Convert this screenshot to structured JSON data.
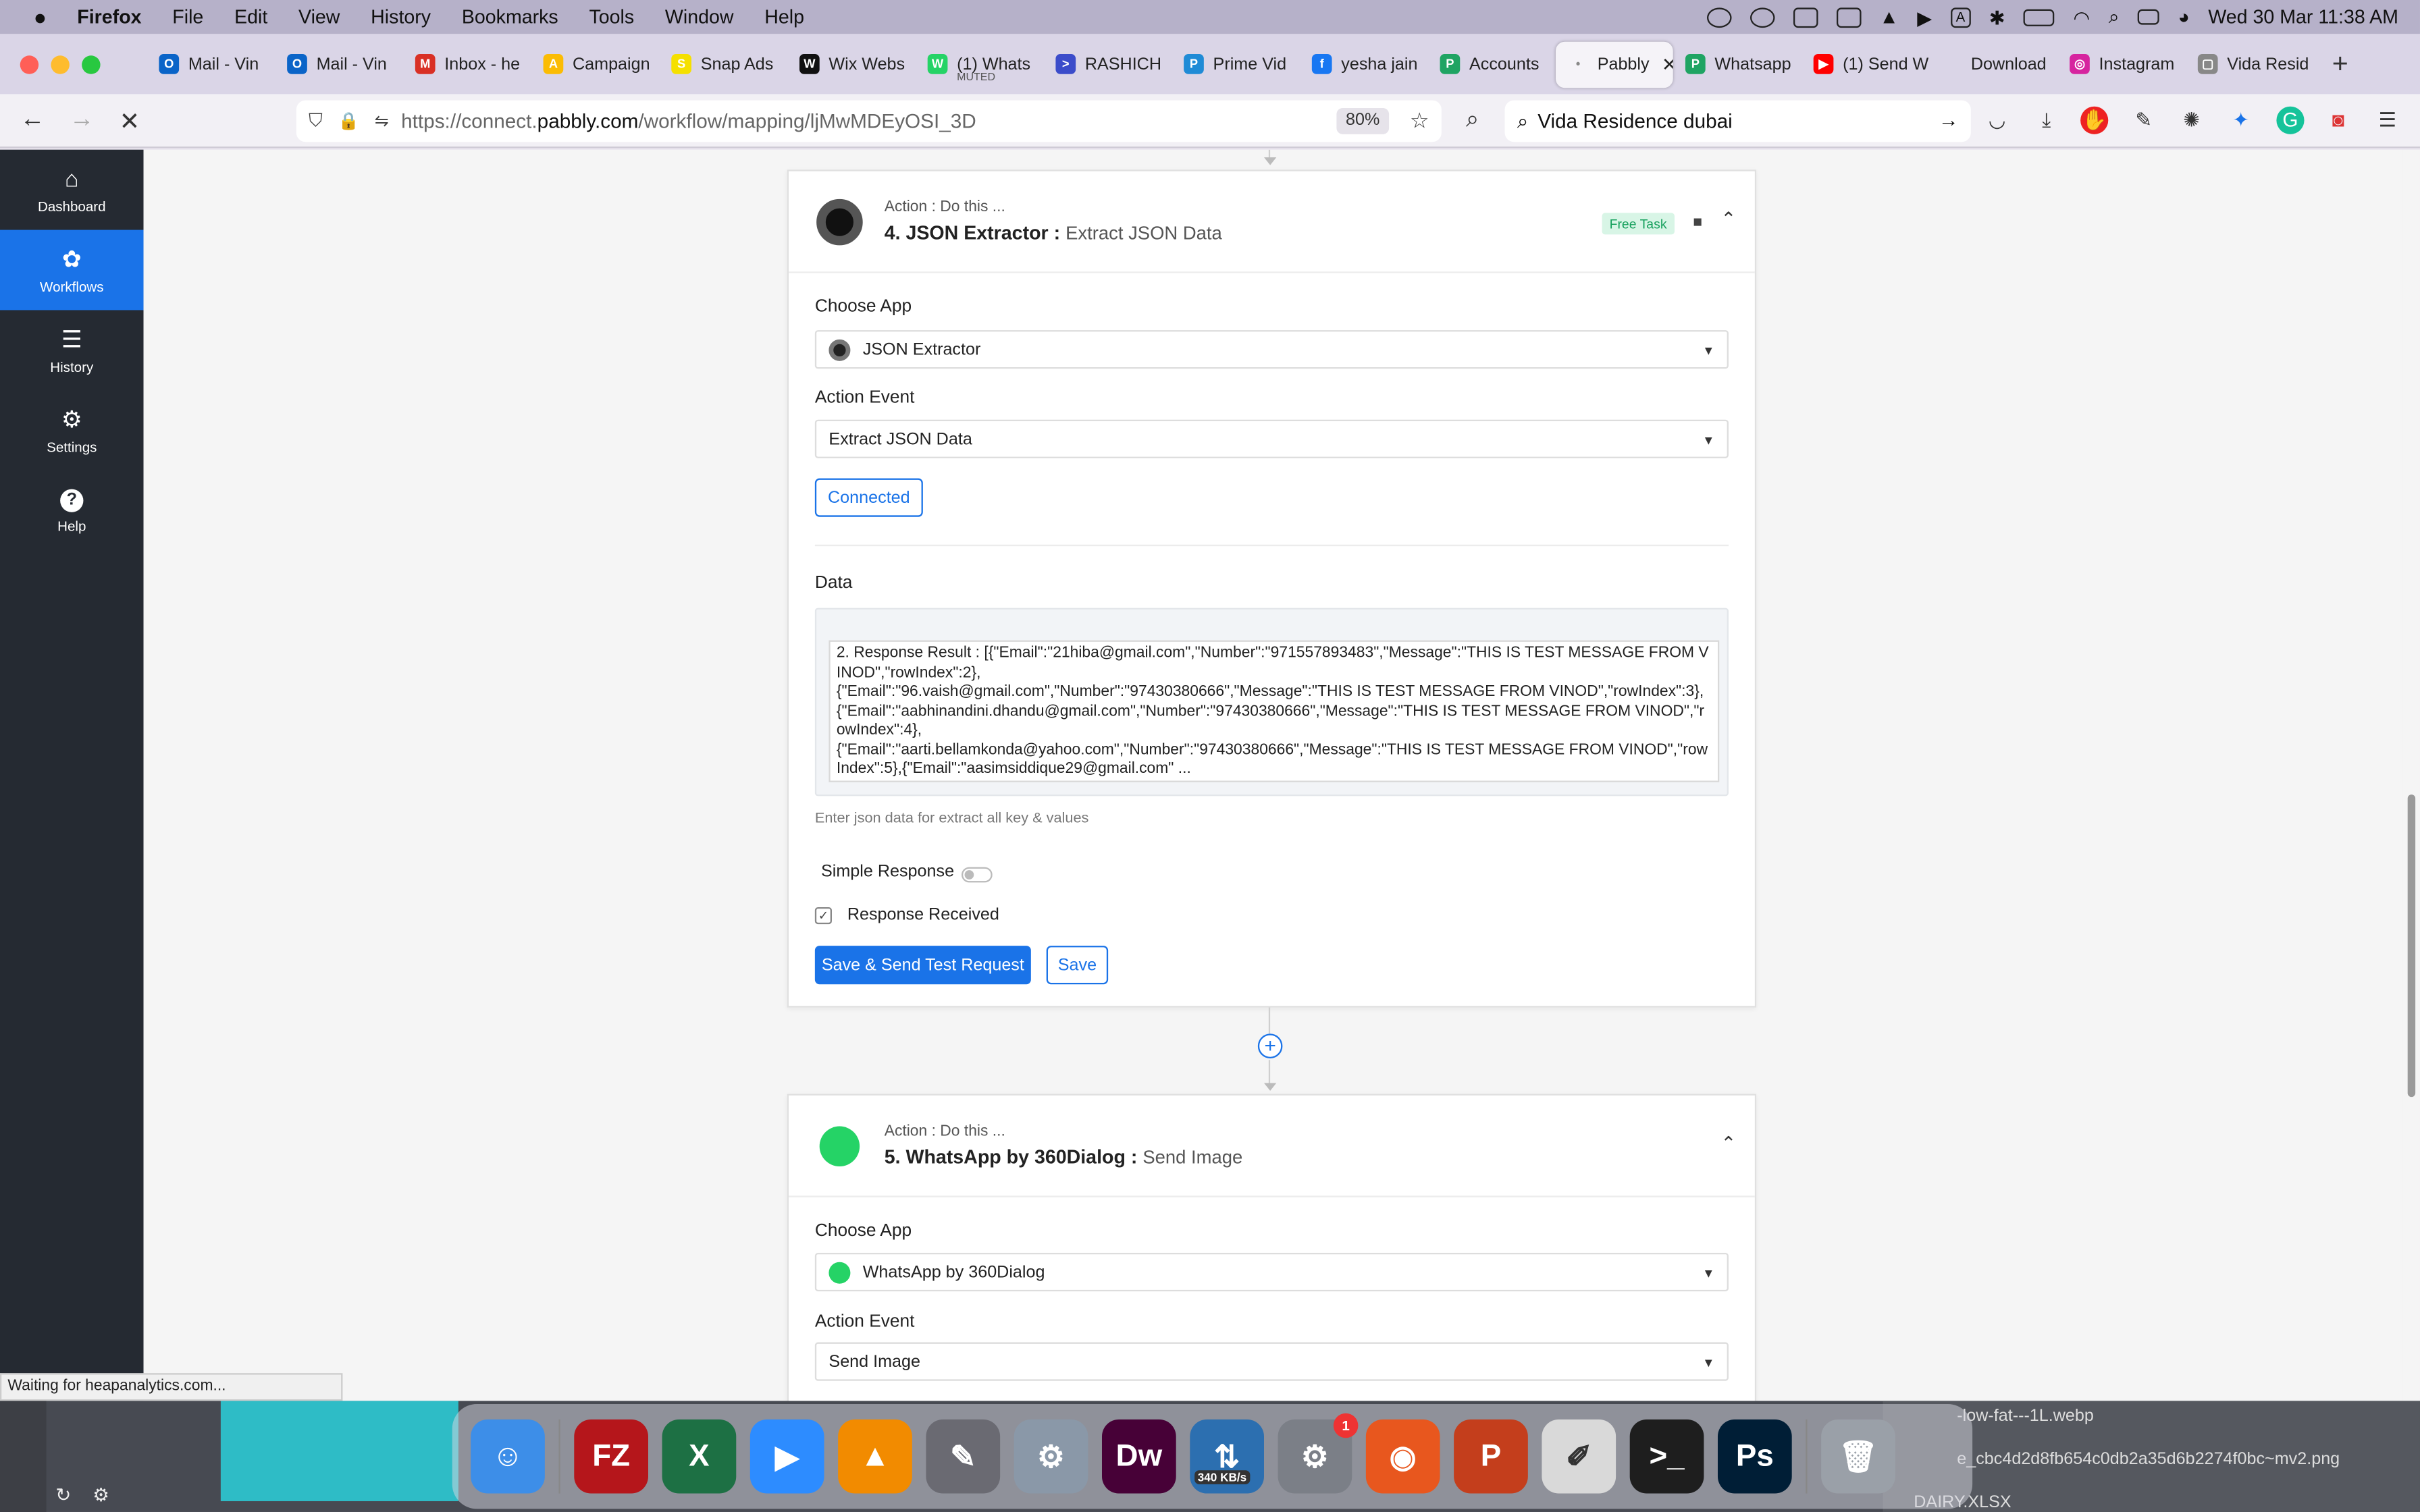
{
  "menubar": {
    "app": "Firefox",
    "items": [
      "File",
      "Edit",
      "View",
      "History",
      "Bookmarks",
      "Tools",
      "Window",
      "Help"
    ],
    "clock": "Wed 30 Mar  11:38 AM"
  },
  "tabs": [
    {
      "label": "Mail - Vin",
      "color": "#0a64c8",
      "glyph": "O"
    },
    {
      "label": "Mail - Vin",
      "color": "#0a64c8",
      "glyph": "O"
    },
    {
      "label": "Inbox - he",
      "color": "#d93025",
      "glyph": "M"
    },
    {
      "label": "Campaign",
      "color": "#fbbc04",
      "glyph": "A"
    },
    {
      "label": "Snap Ads",
      "color": "#f5e000",
      "glyph": "S"
    },
    {
      "label": "Wix Webs",
      "color": "#111111",
      "glyph": "W"
    },
    {
      "label": "(1) Whats",
      "color": "#25d366",
      "glyph": "W"
    },
    {
      "label": "RASHICH",
      "color": "#3b4cca",
      "glyph": ">"
    },
    {
      "label": "Prime Vid",
      "color": "#1f8bd6",
      "glyph": "P"
    },
    {
      "label": "yesha jain",
      "color": "#1877f2",
      "glyph": "f"
    },
    {
      "label": "Accounts",
      "color": "#1fa463",
      "glyph": "P"
    },
    {
      "label": "Pabbly",
      "color": "#888888",
      "glyph": "•"
    },
    {
      "label": "Whatsapp",
      "color": "#1fa463",
      "glyph": "P"
    },
    {
      "label": "(1) Send W",
      "color": "#ff0000",
      "glyph": "▶"
    },
    {
      "label": "Download",
      "color": "#dad5e7",
      "glyph": ""
    },
    {
      "label": "Instagram",
      "color": "#d6249f",
      "glyph": "◎"
    },
    {
      "label": "Vida Resid",
      "color": "#888888",
      "glyph": "▢"
    }
  ],
  "tab_muted_label": "MUTED",
  "url": {
    "prefix": "https://connect.",
    "domain": "pabbly.com",
    "path": "/workflow/mapping/ljMwMDEyOSI_3D",
    "zoom": "80%"
  },
  "search_query": "Vida Residence dubai",
  "sidebar": [
    {
      "label": "Dashboard",
      "icon": "⌂"
    },
    {
      "label": "Workflows",
      "icon": "✿"
    },
    {
      "label": "History",
      "icon": "☰"
    },
    {
      "label": "Settings",
      "icon": "⚙"
    },
    {
      "label": "Help",
      "icon": "?"
    }
  ],
  "step4": {
    "pre": "Action : Do this ...",
    "title": "4. JSON Extractor :",
    "subtitle": "Extract JSON Data",
    "badge": "Free Task",
    "choose_app_label": "Choose App",
    "app": "JSON Extractor",
    "action_event_label": "Action Event",
    "event": "Extract JSON Data",
    "connected": "Connected",
    "data_label": "Data",
    "data_text": "2. Response Result : [{\"Email\":\"21hiba@gmail.com\",\"Number\":\"971557893483\",\"Message\":\"THIS IS TEST MESSAGE FROM VINOD\",\"rowIndex\":2},\n{\"Email\":\"96.vaish@gmail.com\",\"Number\":\"97430380666\",\"Message\":\"THIS IS TEST MESSAGE FROM VINOD\",\"rowIndex\":3},{\"Email\":\"aabhinandini.dhandu@gmail.com\",\"Number\":\"97430380666\",\"Message\":\"THIS IS TEST MESSAGE FROM VINOD\",\"rowIndex\":4},\n{\"Email\":\"aarti.bellamkonda@yahoo.com\",\"Number\":\"97430380666\",\"Message\":\"THIS IS TEST MESSAGE FROM VINOD\",\"rowIndex\":5},{\"Email\":\"aasimsiddique29@gmail.com\" ...",
    "help": "Enter json data for extract all key & values",
    "simple_response": "Simple Response",
    "response_received": "Response Received",
    "save_send": "Save & Send Test Request",
    "save": "Save"
  },
  "step5": {
    "pre": "Action : Do this ...",
    "title": "5. WhatsApp by 360Dialog :",
    "subtitle": "Send Image",
    "choose_app_label": "Choose App",
    "app": "WhatsApp by 360Dialog",
    "action_event_label": "Action Event",
    "event": "Send Image"
  },
  "status_text": "Waiting for heapanalytics.com...",
  "dock": [
    {
      "name": "finder",
      "color": "#3d8ee8",
      "glyph": "☺"
    },
    {
      "name": "filezilla",
      "color": "#b5161b",
      "glyph": "FZ"
    },
    {
      "name": "excel",
      "color": "#1d7044",
      "glyph": "X"
    },
    {
      "name": "zoom",
      "color": "#2d8cff",
      "glyph": "▶"
    },
    {
      "name": "vlc",
      "color": "#f28b00",
      "glyph": "▲"
    },
    {
      "name": "quill",
      "color": "#6a6a72",
      "glyph": "✎"
    },
    {
      "name": "system-utility",
      "color": "#8a98a8",
      "glyph": "⚙"
    },
    {
      "name": "dreamweaver",
      "color": "#470137",
      "glyph": "Dw"
    },
    {
      "name": "network-monitor",
      "color": "#2c6fb0",
      "glyph": "⇅"
    },
    {
      "name": "system-preferences",
      "color": "#7b7f87",
      "glyph": "⚙"
    },
    {
      "name": "firefox",
      "color": "#e8571e",
      "glyph": "◉"
    },
    {
      "name": "powerpoint",
      "color": "#c43e1c",
      "glyph": "P"
    },
    {
      "name": "textedit",
      "color": "#d9d9d9",
      "glyph": "✐"
    },
    {
      "name": "terminal",
      "color": "#1e1e1e",
      "glyph": ">_"
    },
    {
      "name": "photoshop",
      "color": "#001e36",
      "glyph": "Ps"
    },
    {
      "name": "trash",
      "color": "#9aa0a8",
      "glyph": "🗑"
    }
  ],
  "dock_badge": "1",
  "dock_speed": "340 KB/s",
  "desktop_files": [
    "-low-fat---1L.webp",
    "e_cbc4d2d8fb654c0db2a35d6b2274f0bc~mv2.png",
    "DAIRY.XLSX"
  ]
}
